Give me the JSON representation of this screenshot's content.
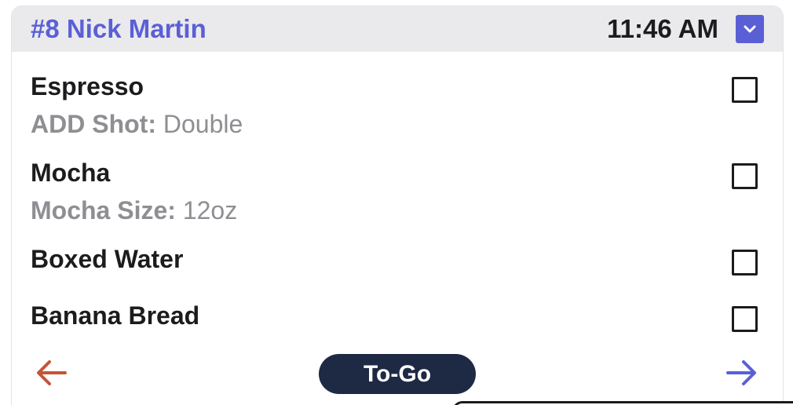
{
  "theme": {
    "accent": "#5b5fd6",
    "back_arrow_color": "#c4553a",
    "next_arrow_color": "#5b5fd6",
    "pill_color": "#1e2a44"
  },
  "order": {
    "title": "#8 Nick Martin",
    "time": "11:46 AM",
    "collapse_icon": "chevron-down-icon"
  },
  "items": [
    {
      "name": "Espresso",
      "modifier_label": "ADD Shot:",
      "modifier_value": " Double",
      "checked": false
    },
    {
      "name": "Mocha",
      "modifier_label": "Mocha Size:",
      "modifier_value": " 12oz",
      "checked": false
    },
    {
      "name": "Boxed Water",
      "checked": false
    },
    {
      "name": "Banana Bread",
      "checked": false
    }
  ],
  "footer": {
    "back_icon": "arrow-left-icon",
    "order_type": "To-Go",
    "next_icon": "arrow-right-icon"
  }
}
